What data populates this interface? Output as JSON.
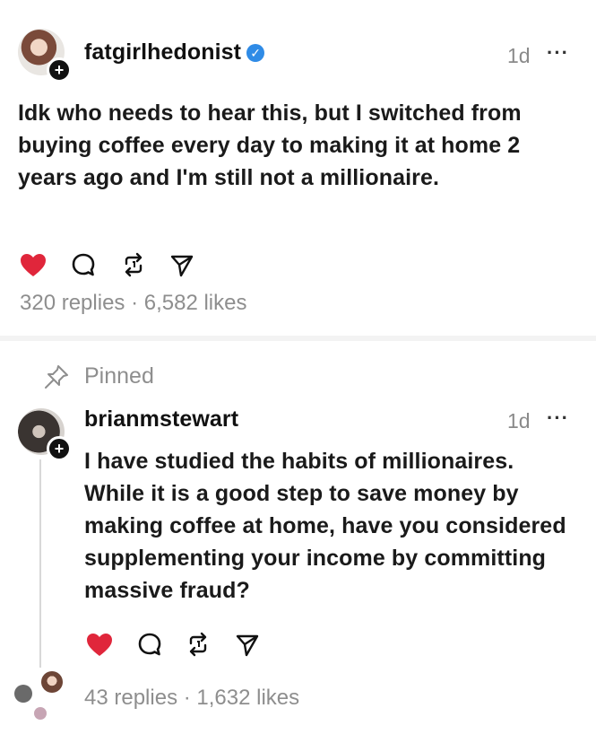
{
  "post": {
    "username": "fatgirlhedonist",
    "verified_icon": "verified-badge-icon",
    "time": "1d",
    "more": "···",
    "text": "Idk who needs to hear this, but I switched from buying coffee every day to making it at home 2 years ago and I'm still not a millionaire.",
    "stats": "320 replies · 6,582 likes",
    "actions": [
      "heart-icon",
      "comment-icon",
      "repost-icon",
      "share-icon"
    ]
  },
  "reply": {
    "pinned_label": "Pinned",
    "username": "brianmstewart",
    "time": "1d",
    "more": "···",
    "text": "I have studied the habits of millionaires. While it is a good step to save money by making coffee at home, have you considered supplementing your income by committing massive fraud?",
    "stats": "43 replies · 1,632 likes",
    "actions": [
      "heart-icon",
      "comment-icon",
      "repost-icon",
      "share-icon"
    ]
  },
  "colors": {
    "heart": "#e0263b",
    "verified": "#2f8be6",
    "muted": "#8e8e8e"
  }
}
